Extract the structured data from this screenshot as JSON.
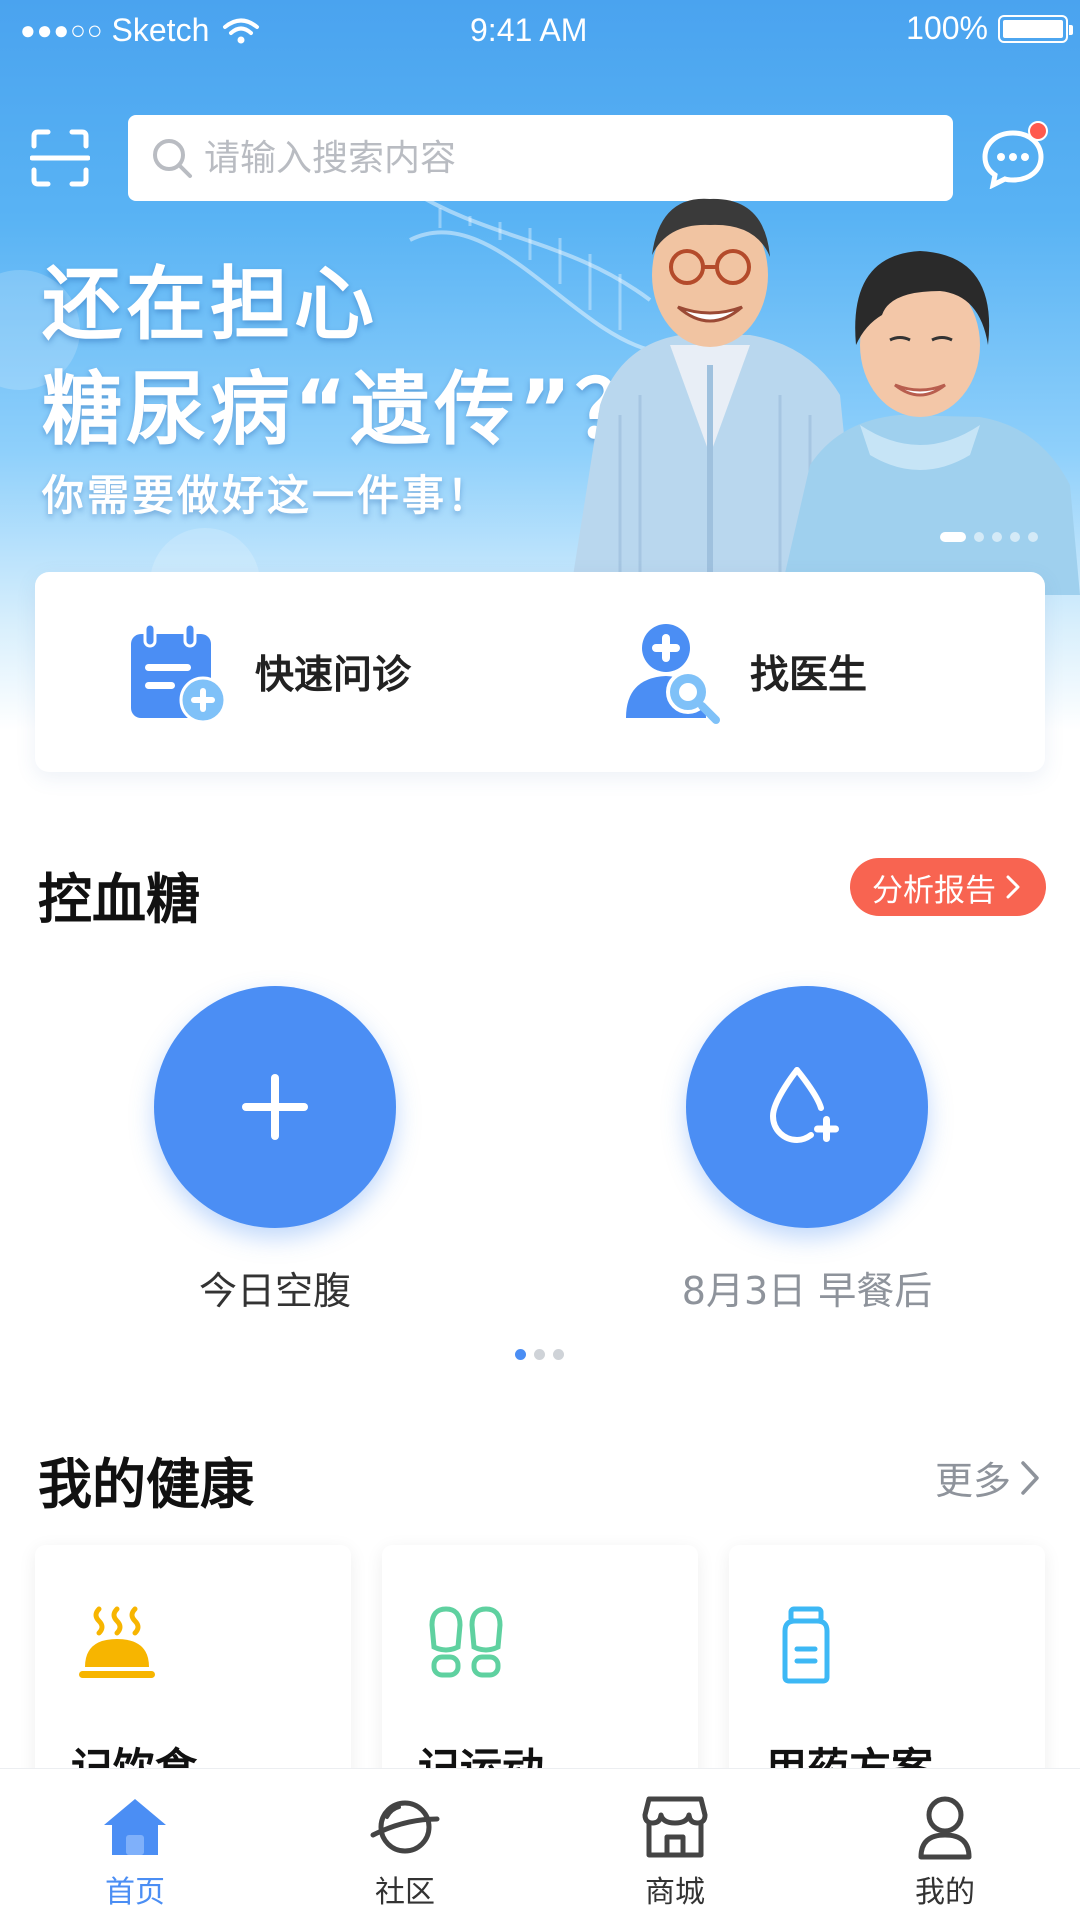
{
  "status_bar": {
    "signal": "●●●○○",
    "carrier": "Sketch",
    "time": "9:41 AM",
    "battery": "100%"
  },
  "header": {
    "scan_icon": "scan-icon",
    "search_placeholder": "请输入搜索内容",
    "message_icon": "chat-bubble-icon",
    "has_unread": true
  },
  "banner": {
    "line1": "还在担心",
    "line2": "糖尿病“遗传”？",
    "line3": "你需要做好这一件事！",
    "slide_count": 5,
    "active_slide": 1
  },
  "quick_actions": [
    {
      "label": "快速问诊",
      "icon": "clipboard-plus-icon"
    },
    {
      "label": "找医生",
      "icon": "doctor-search-icon"
    }
  ],
  "blood_sugar": {
    "title": "控血糖",
    "report_button": "分析报告",
    "buttons": [
      {
        "label": "今日空腹",
        "icon": "plus-icon"
      },
      {
        "label": "8月3日 早餐后",
        "icon": "drop-plus-icon"
      }
    ],
    "page_count": 3,
    "active_page": 1
  },
  "my_health": {
    "title": "我的健康",
    "more_label": "更多",
    "cards": [
      {
        "label": "记饮食",
        "icon": "food-tray-icon"
      },
      {
        "label": "记运动",
        "icon": "footprints-icon"
      },
      {
        "label": "用药方案",
        "icon": "medicine-bottle-icon"
      }
    ]
  },
  "tab_bar": {
    "items": [
      {
        "label": "首页",
        "icon": "home-icon",
        "active": true
      },
      {
        "label": "社区",
        "icon": "planet-icon",
        "active": false
      },
      {
        "label": "商城",
        "icon": "store-icon",
        "active": false
      },
      {
        "label": "我的",
        "icon": "user-icon",
        "active": false
      }
    ]
  },
  "colors": {
    "primary": "#4B8EF4",
    "accent_red": "#F86451",
    "food_yellow": "#F7B500",
    "sport_green": "#5FD1A0",
    "med_blue": "#3DB8F5"
  }
}
